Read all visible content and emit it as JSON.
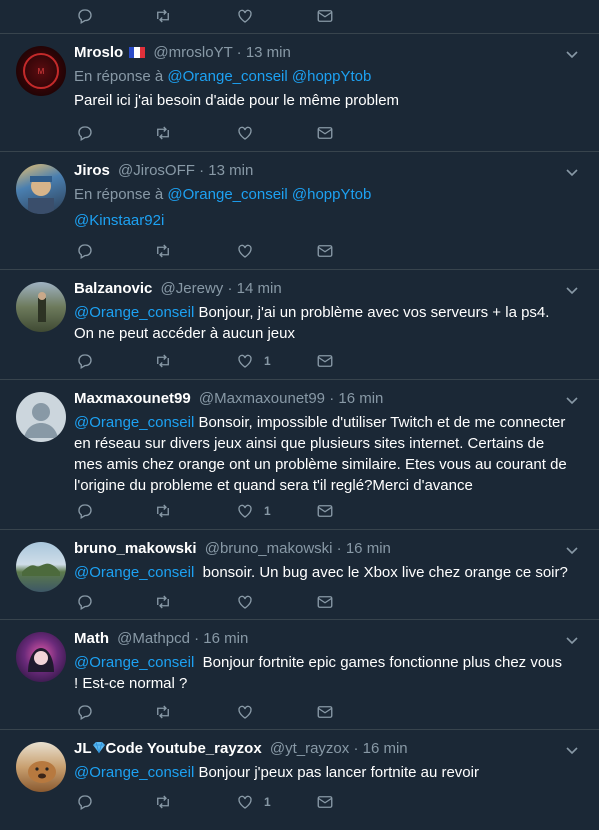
{
  "colors": {
    "background": "#1b2836",
    "link": "#1da1f2",
    "muted": "#8899a6",
    "divider": "#38444d"
  },
  "top_actions": {
    "icons": [
      "reply-icon",
      "retweet-icon",
      "like-icon",
      "message-icon"
    ]
  },
  "tweets": [
    {
      "name": "Mroslo",
      "name_suffix_icon": "french-flag-icon",
      "handle": "@mrosloYT",
      "separator": "·",
      "time": "13 min",
      "reply_prefix": "En réponse à",
      "reply_to": [
        "@Orange_conseil",
        "@hoppYtob"
      ],
      "mention": "",
      "text": "Pareil ici j'ai besoin d'aide pour le même problem",
      "likes": ""
    },
    {
      "name": "Jiros",
      "handle": "@JirosOFF",
      "separator": "·",
      "time": "13 min",
      "reply_prefix": "En réponse à",
      "reply_to": [
        "@Orange_conseil",
        "@hoppYtob"
      ],
      "mention": "@Kinstaar92i",
      "text": "",
      "likes": ""
    },
    {
      "name": "Balzanovic",
      "handle": "@Jerewy",
      "separator": "·",
      "time": "14 min",
      "mention": "@Orange_conseil",
      "text": " Bonjour, j'ai un problème avec vos serveurs + la ps4. On ne peut accéder à aucun jeux",
      "likes": "1"
    },
    {
      "name": "Maxmaxounet99",
      "handle": "@Maxmaxounet99",
      "separator": "·",
      "time": "16 min",
      "mention": "@Orange_conseil",
      "text": " Bonsoir, impossible d'utiliser Twitch et de me connecter en réseau sur divers jeux ainsi que plusieurs sites internet. Certains de mes amis chez orange ont un problème similaire. Etes vous au courant de l'origine du probleme et quand sera t'il reglé?Merci d'avance",
      "likes": "1"
    },
    {
      "name": "bruno_makowski",
      "handle": "@bruno_makowski",
      "separator": "·",
      "time": "16 min",
      "mention": "@Orange_conseil",
      "text": "  bonsoir. Un bug avec le Xbox live chez orange ce soir?",
      "likes": ""
    },
    {
      "name": "Math",
      "handle": "@Mathpcd",
      "separator": "·",
      "time": "16 min",
      "mention": "@Orange_conseil",
      "text": "  Bonjour fortnite epic games fonctionne plus chez vous ! Est-ce normal ?",
      "likes": ""
    },
    {
      "name_prefix": "JL",
      "name_icon": "blue-diamond-icon",
      "name": "Code Youtube_rayzox",
      "handle": "@yt_rayzox",
      "separator": "·",
      "time": "16 min",
      "mention": "@Orange_conseil",
      "text": " Bonjour j'peux pas lancer fortnite au revoir",
      "likes": "1"
    }
  ]
}
